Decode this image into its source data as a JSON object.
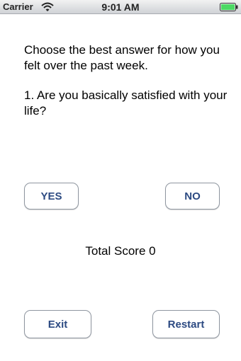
{
  "status_bar": {
    "carrier": "Carrier",
    "time": "9:01 AM",
    "wifi_icon": "wifi-icon",
    "battery_icon": "battery-icon",
    "battery_level": 1.0,
    "battery_color": "#4cd964"
  },
  "main": {
    "prompt": "Choose the best answer for how you felt over the past week.",
    "question": "1. Are you basically satisfied with your life?",
    "yes_label": "YES",
    "no_label": "NO",
    "score_text": "Total Score 0",
    "exit_label": "Exit",
    "restart_label": "Restart",
    "button_text_color": "#2c4a82"
  }
}
